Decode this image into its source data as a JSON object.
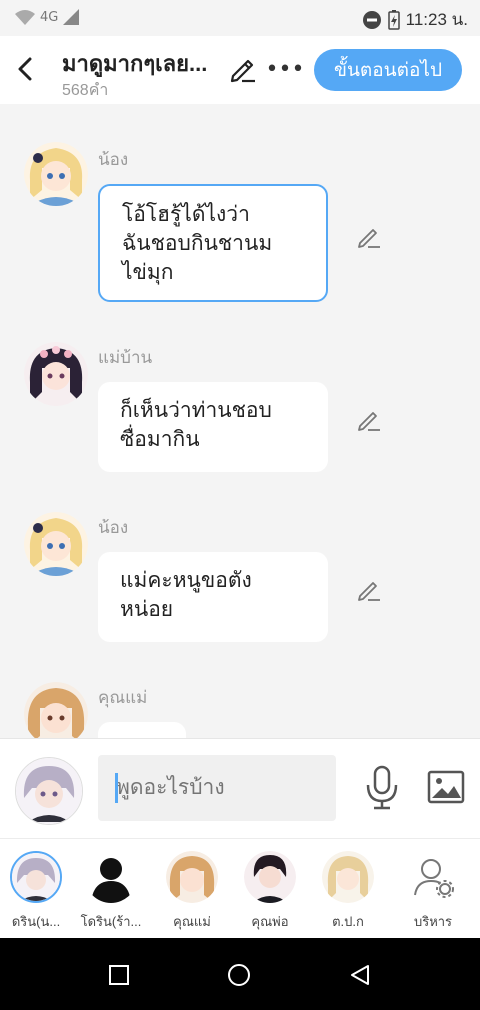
{
  "status": {
    "network": "4G",
    "time": "11:23 น."
  },
  "header": {
    "title": "มาดูมากๆเลย...",
    "subtitle": "568คำ",
    "next_label": "ขั้นตอนต่อไป"
  },
  "messages": [
    {
      "name": "น้อง",
      "lines": [
        "โอ้โฮรู้ได้ไงว่า",
        "ฉันชอบกินชานม",
        "ไข่มุก"
      ]
    },
    {
      "name": "แม่บ้าน",
      "lines": [
        "ก็เห็นว่าท่านชอบ",
        "ซื่อมากิน"
      ]
    },
    {
      "name": "น้อง",
      "lines": [
        "แม่คะหนูขอตัง",
        "หน่อย"
      ]
    },
    {
      "name": "คุณแม่",
      "lines": [
        ""
      ]
    }
  ],
  "composer": {
    "placeholder": "พูดอะไรบ้าง"
  },
  "cast": [
    {
      "label": "ดริน(น..."
    },
    {
      "label": "โดริน(ร้า..."
    },
    {
      "label": "คุณแม่"
    },
    {
      "label": "คุณพ่อ"
    },
    {
      "label": "ต.ป.ก"
    },
    {
      "label": "บริหาร"
    }
  ],
  "colors": {
    "accent": "#55a8f5",
    "background": "#f4f4f4"
  }
}
